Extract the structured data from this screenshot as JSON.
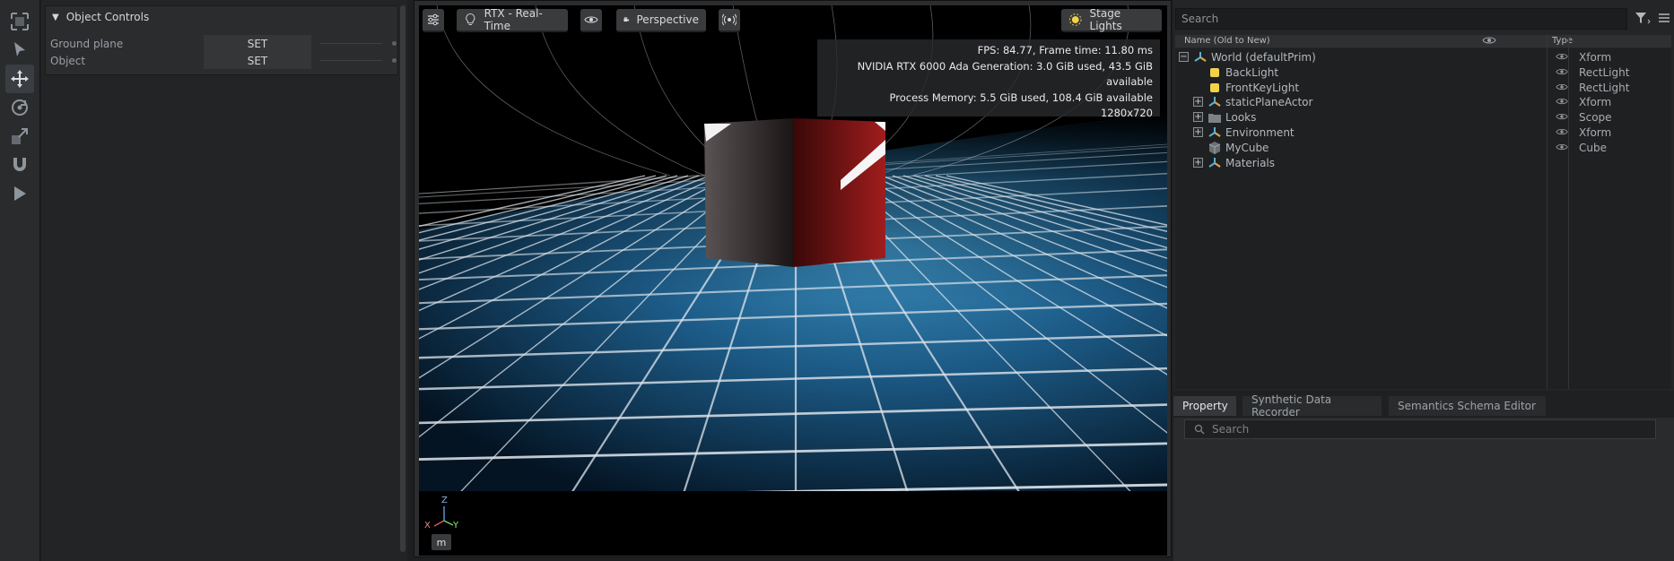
{
  "toolbar_left": {
    "tools": [
      {
        "name": "select-mode-icon"
      },
      {
        "name": "select-arrow-icon"
      },
      {
        "name": "move-icon"
      },
      {
        "name": "rotate-icon"
      },
      {
        "name": "scale-icon"
      },
      {
        "name": "snap-magnet-icon"
      },
      {
        "name": "play-icon"
      }
    ]
  },
  "object_controls": {
    "title": "Object Controls",
    "rows": [
      {
        "label": "Ground plane",
        "button": "SET"
      },
      {
        "label": "Object",
        "button": "SET"
      }
    ]
  },
  "viewport": {
    "toolbar": {
      "render_mode": "RTX - Real-Time",
      "camera": "Perspective",
      "lights": "Stage Lights"
    },
    "stats": {
      "line1": "FPS: 84.77, Frame time: 11.80 ms",
      "line2": "NVIDIA RTX 6000 Ada Generation: 3.0 GiB used, 43.5 GiB available",
      "line3": "Process Memory: 5.5 GiB used, 108.4 GiB available",
      "line4": "1280x720"
    },
    "axis": {
      "z": "Z",
      "x": "X",
      "y": "Y"
    },
    "units_button": "m",
    "colors": {
      "floor": "#1c5a86",
      "cube": "#8a1414",
      "grid": "#dfe6ec"
    }
  },
  "stage": {
    "search_placeholder": "Search",
    "columns": {
      "name": "Name (Old to New)",
      "type": "Type"
    },
    "items": [
      {
        "name": "World (defaultPrim)",
        "type": "Xform",
        "depth": 0,
        "expander": "−",
        "icon": "xform-icon",
        "eye": true
      },
      {
        "name": "BackLight",
        "type": "RectLight",
        "depth": 1,
        "expander": "",
        "icon": "light-icon",
        "eye": true
      },
      {
        "name": "FrontKeyLight",
        "type": "RectLight",
        "depth": 1,
        "expander": "",
        "icon": "light-icon",
        "eye": true
      },
      {
        "name": "staticPlaneActor",
        "type": "Xform",
        "depth": 1,
        "expander": "+",
        "icon": "xform-icon",
        "eye": true
      },
      {
        "name": "Looks",
        "type": "Scope",
        "depth": 1,
        "expander": "+",
        "icon": "folder-icon",
        "eye": true
      },
      {
        "name": "Environment",
        "type": "Xform",
        "depth": 1,
        "expander": "+",
        "icon": "xform-icon",
        "eye": true
      },
      {
        "name": "MyCube",
        "type": "Cube",
        "depth": 1,
        "expander": "",
        "icon": "cube-icon",
        "eye": true
      },
      {
        "name": "Materials",
        "type": "",
        "depth": 1,
        "expander": "+",
        "icon": "xform-icon",
        "eye": false
      }
    ]
  },
  "property": {
    "tabs": [
      "Property",
      "Synthetic Data Recorder",
      "Semantics Schema Editor"
    ],
    "active_tab": "Property",
    "search_placeholder": "Search"
  }
}
